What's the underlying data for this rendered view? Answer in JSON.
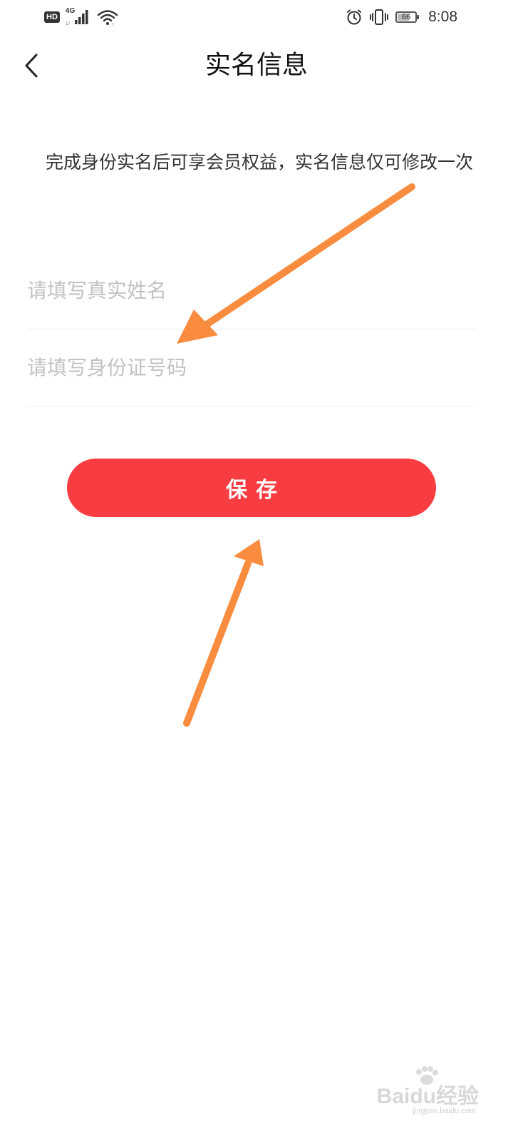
{
  "status_bar": {
    "hd_label": "HD",
    "network_type": "4G",
    "battery_level": "66",
    "battery_fraction": 0.66,
    "time": "8:08",
    "icons": [
      "signal-bars-icon",
      "wifi-icon",
      "alarm-clock-icon",
      "vibrate-icon",
      "battery-icon"
    ]
  },
  "header": {
    "title": "实名信息",
    "back_icon": "chevron-left-icon"
  },
  "notice": {
    "text": "完成身份实名后可享会员权益，实名信息仅可修改一次"
  },
  "form": {
    "name_field": {
      "placeholder": "请填写真实姓名",
      "value": ""
    },
    "id_field": {
      "placeholder": "请填写身份证号码",
      "value": ""
    },
    "save_label": "保存"
  },
  "watermark": {
    "main": "Baidu经验",
    "sub": "jingyan.baidu.com"
  },
  "colors": {
    "primary_button": "#f73d41",
    "annotation_arrow": "#f98c3e",
    "placeholder": "#c2c2c2",
    "divider": "#ececec"
  }
}
